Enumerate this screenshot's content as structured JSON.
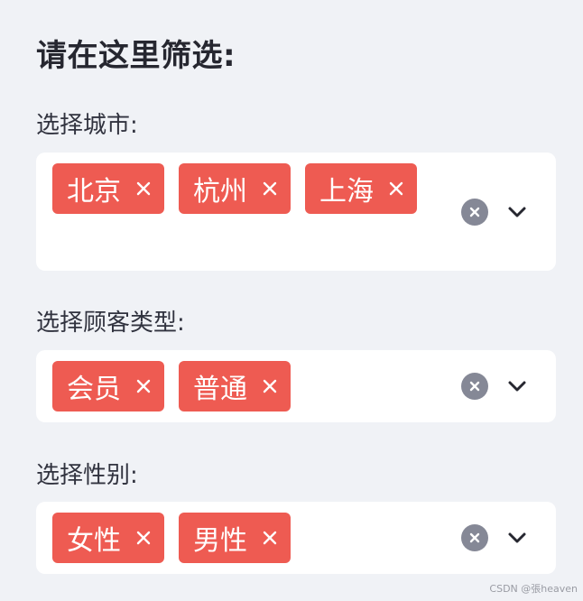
{
  "sidebar": {
    "heading": "请在这里筛选:",
    "filters": [
      {
        "label": "选择城市:",
        "tags": [
          "北京",
          "杭州",
          "上海"
        ]
      },
      {
        "label": "选择顾客类型:",
        "tags": [
          "会员",
          "普通"
        ]
      },
      {
        "label": "选择性别:",
        "tags": [
          "女性",
          "男性"
        ]
      }
    ]
  },
  "icons": {
    "tag_remove": "close-icon",
    "clear_all": "clear-circle-icon",
    "dropdown": "chevron-down-icon"
  },
  "colors": {
    "background": "#f0f2f6",
    "tag": "#ee5b52",
    "clear_button": "#858896",
    "select_background": "#ffffff",
    "text": "#31333f"
  },
  "watermark": "CSDN @張heaven"
}
